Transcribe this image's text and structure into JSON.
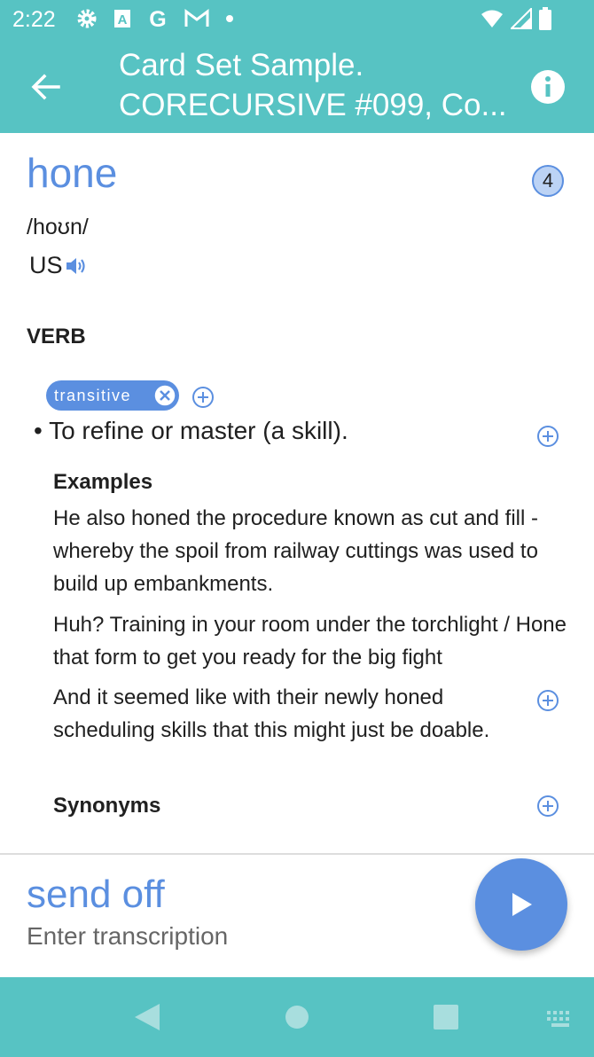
{
  "status_bar": {
    "time": "2:22",
    "icons": [
      "gear-icon",
      "app-a-icon",
      "google-icon",
      "gmail-icon",
      "dot-icon",
      "wifi-icon",
      "signal-icon",
      "battery-icon"
    ]
  },
  "app_bar": {
    "title_line1": "Card Set Sample.",
    "title_line2": "CORECURSIVE #099, Co...",
    "back_icon": "arrow-back-icon",
    "info_icon": "info-icon"
  },
  "card": {
    "word": "hone",
    "count": "4",
    "phonetic": "/hoʊn/",
    "accent": "US",
    "part_of_speech": "VERB",
    "tag": "transitive",
    "definition": "• To refine or master (a skill).",
    "examples_title": "Examples",
    "examples": [
      "He also honed the procedure known as cut and fill - whereby the spoil from railway cuttings was used to build up embankments.",
      "Huh? Training in your room under the torchlight / Hone that form to get you ready for the big fight",
      "And it seemed like with their newly honed scheduling skills that this might just be doable."
    ],
    "synonyms_title": "Synonyms"
  },
  "next": {
    "word": "send off",
    "placeholder": "Enter transcription"
  },
  "colors": {
    "teal": "#57c3c3",
    "accent_blue": "#5b8fe0"
  }
}
